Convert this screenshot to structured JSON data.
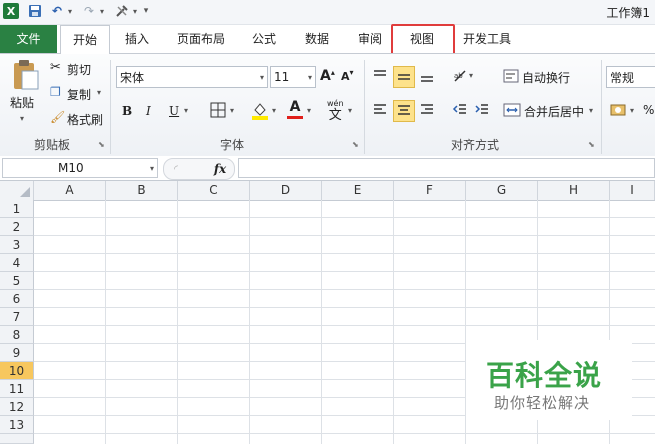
{
  "window": {
    "title": "工作簿1"
  },
  "quick_access": {
    "logo_label": "X",
    "icons": [
      "excel-logo",
      "save-icon",
      "undo-icon",
      "redo-icon",
      "tools-icon",
      "customize-icon"
    ]
  },
  "tabs": [
    {
      "label": "文件"
    },
    {
      "label": "开始"
    },
    {
      "label": "插入"
    },
    {
      "label": "页面布局"
    },
    {
      "label": "公式"
    },
    {
      "label": "数据"
    },
    {
      "label": "审阅"
    },
    {
      "label": "视图"
    },
    {
      "label": "开发工具"
    }
  ],
  "ribbon": {
    "clipboard": {
      "paste": "粘贴",
      "cut": "剪切",
      "copy": "复制",
      "format_painter": "格式刷",
      "group_label": "剪贴板"
    },
    "font": {
      "font_name": "宋体",
      "font_size": "11",
      "bold": "B",
      "italic": "I",
      "underline": "U",
      "grow": "A",
      "shrink": "A",
      "font_color_letter": "A",
      "phonetic": "wén",
      "phonetic_char": "文",
      "group_label": "字体"
    },
    "alignment": {
      "wrap_text": "自动换行",
      "merge_center": "合并后居中",
      "group_label": "对齐方式"
    },
    "number": {
      "format": "常规",
      "percent": "%"
    }
  },
  "formula_bar": {
    "name_box": "M10",
    "fx": "fx",
    "value": ""
  },
  "grid": {
    "columns": [
      "A",
      "B",
      "C",
      "D",
      "E",
      "F",
      "G",
      "H",
      "I"
    ],
    "rows": [
      "1",
      "2",
      "3",
      "4",
      "5",
      "6",
      "7",
      "8",
      "9",
      "10",
      "11",
      "12",
      "13"
    ],
    "active_row": "10"
  },
  "watermark": {
    "title": "百科全说",
    "subtitle": "助你轻松解决"
  },
  "colors": {
    "file_tab": "#2a8143",
    "highlight_box": "#e03c3c",
    "active_row_header": "#f7c75e"
  }
}
